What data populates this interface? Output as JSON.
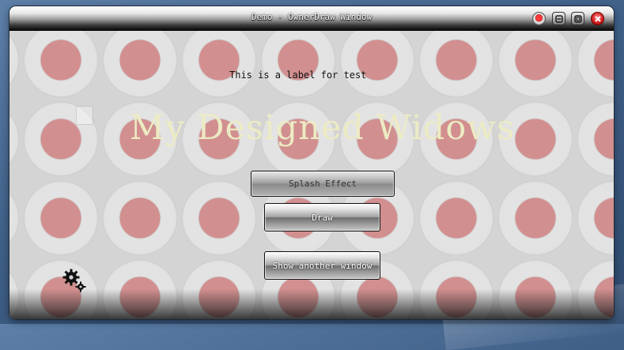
{
  "window": {
    "title": "Demo - OwnerDraw Window",
    "controls": {
      "record": "record-icon",
      "minimize": "minimize-icon",
      "maximize": "maximize-icon",
      "close": "close-icon"
    }
  },
  "content": {
    "test_label": "This is a label for test",
    "heading": "My Designed Widows",
    "buttons": {
      "splash": "Splash Effect",
      "draw": "Draw",
      "show_another": "Show another window"
    },
    "settings_icon": "gears-icon"
  },
  "colors": {
    "heading": "#ecebc4",
    "disc_center": "#d17878",
    "close_button": "#d21d1d"
  }
}
